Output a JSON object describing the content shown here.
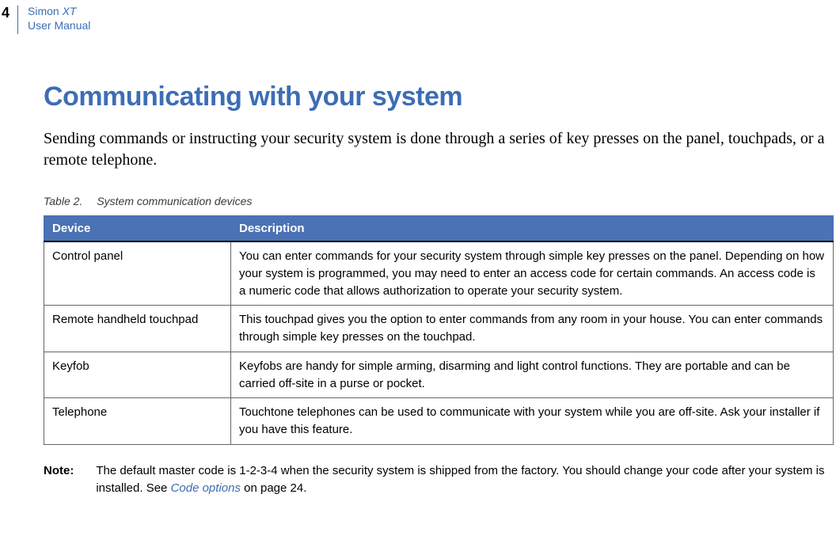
{
  "header": {
    "page_number": "4",
    "brand_line1a": "Simon ",
    "brand_line1b": "XT",
    "brand_line2": "User Manual"
  },
  "heading": "Communicating with your system",
  "intro": "Sending commands or instructing your security system is done through a series of key presses on the panel, touchpads, or a remote telephone.",
  "table": {
    "caption_label": "Table 2.",
    "caption_title": "System communication devices",
    "head_device": "Device",
    "head_description": "Description",
    "rows": [
      {
        "device": "Control panel",
        "description": "You can enter commands for your security system through simple key presses on the panel. Depending on how your system is programmed, you may need to enter an access code for certain commands. An access code is a numeric code that allows authorization to operate your security system."
      },
      {
        "device": "Remote handheld touchpad",
        "description": "This touchpad gives you the option to enter commands from any room in your house. You can enter commands through simple key presses on the touchpad."
      },
      {
        "device": "Keyfob",
        "description": "Keyfobs are handy for simple arming, disarming and light control functions. They are portable and can be carried off-site in a purse or pocket."
      },
      {
        "device": "Telephone",
        "description": "Touchtone telephones can be used to communicate with your system while you are off-site. Ask your installer if you have this feature."
      }
    ]
  },
  "note": {
    "label": "Note:",
    "text_before": "The default master code is 1-2-3-4 when the security system is shipped from the factory. You should change your code after your system is installed. See ",
    "link_text": "Code options",
    "text_after": " on page 24."
  }
}
